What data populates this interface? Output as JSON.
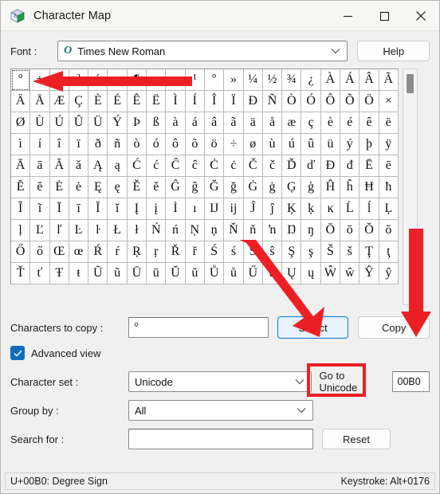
{
  "window": {
    "title": "Character Map",
    "icon": "character-map-icon",
    "minimize": "minimize-icon",
    "maximize": "maximize-icon",
    "close": "close-icon"
  },
  "font_row": {
    "label": "Font :",
    "value": "Times New Roman",
    "type_badge": "O",
    "help_label": "Help"
  },
  "grid": {
    "selected_index": 0,
    "rows": [
      [
        "°",
        "±",
        "²",
        "³",
        "´",
        "µ",
        "¶",
        "·",
        "¸",
        "¹",
        "º",
        "»",
        "¼",
        "½",
        "¾",
        "¿",
        "À",
        "Á",
        "Â",
        "Ã"
      ],
      [
        "Ä",
        "Å",
        "Æ",
        "Ç",
        "È",
        "É",
        "Ê",
        "Ë",
        "Ì",
        "Í",
        "Î",
        "Ï",
        "Ð",
        "Ñ",
        "Ò",
        "Ó",
        "Ô",
        "Õ",
        "Ö",
        "×"
      ],
      [
        "Ø",
        "Ù",
        "Ú",
        "Û",
        "Ü",
        "Ý",
        "Þ",
        "ß",
        "à",
        "á",
        "â",
        "ã",
        "ä",
        "å",
        "æ",
        "ç",
        "è",
        "é",
        "ê",
        "ë"
      ],
      [
        "ì",
        "í",
        "î",
        "ï",
        "ð",
        "ñ",
        "ò",
        "ó",
        "ô",
        "õ",
        "ö",
        "÷",
        "ø",
        "ù",
        "ú",
        "û",
        "ü",
        "ý",
        "þ",
        "ÿ"
      ],
      [
        "Ā",
        "ā",
        "Ă",
        "ă",
        "Ą",
        "ą",
        "Ć",
        "ć",
        "Ĉ",
        "ĉ",
        "Ċ",
        "ċ",
        "Č",
        "č",
        "Ď",
        "ď",
        "Đ",
        "đ",
        "Ē",
        "ē"
      ],
      [
        "Ĕ",
        "ĕ",
        "Ė",
        "ė",
        "Ę",
        "ę",
        "Ě",
        "ě",
        "Ĝ",
        "ĝ",
        "Ğ",
        "ğ",
        "Ġ",
        "ġ",
        "Ģ",
        "ģ",
        "Ĥ",
        "ĥ",
        "Ħ",
        "ħ"
      ],
      [
        "Ĩ",
        "ĩ",
        "Ī",
        "ī",
        "Ĭ",
        "ĭ",
        "Į",
        "į",
        "İ",
        "ı",
        "Ĳ",
        "ĳ",
        "Ĵ",
        "ĵ",
        "Ķ",
        "ķ",
        "ĸ",
        "Ĺ",
        "ĺ",
        "Ļ"
      ],
      [
        "ļ",
        "Ľ",
        "ľ",
        "Ŀ",
        "ŀ",
        "Ł",
        "ł",
        "Ń",
        "ń",
        "Ņ",
        "ņ",
        "Ň",
        "ň",
        "ŉ",
        "Ŋ",
        "ŋ",
        "Ō",
        "ō",
        "Ŏ",
        "ŏ"
      ],
      [
        "Ő",
        "ő",
        "Œ",
        "œ",
        "Ŕ",
        "ŕ",
        "Ŗ",
        "ŗ",
        "Ř",
        "ř",
        "Ś",
        "ś",
        "Ŝ",
        "ŝ",
        "Ş",
        "ş",
        "Š",
        "š",
        "Ţ",
        "ţ"
      ],
      [
        "Ť",
        "ť",
        "Ŧ",
        "ŧ",
        "Ũ",
        "ũ",
        "Ū",
        "ū",
        "Ŭ",
        "ŭ",
        "Ů",
        "ů",
        "Ű",
        "ű",
        "Ų",
        "ų",
        "Ŵ",
        "ŵ",
        "Ŷ",
        "ŷ"
      ]
    ]
  },
  "copy_row": {
    "label": "Characters to copy :",
    "value": "°",
    "select_label": "Select",
    "copy_label": "Copy"
  },
  "advanced": {
    "label": "Advanced view",
    "checked": true,
    "check_icon": "checkmark-icon"
  },
  "charset_row": {
    "label": "Character set :",
    "value": "Unicode",
    "goto_label": "Go to Unicode",
    "goto_value": "00B0"
  },
  "groupby_row": {
    "label": "Group by :",
    "value": "All"
  },
  "search_row": {
    "label": "Search for :",
    "value": "",
    "reset_label": "Reset"
  },
  "status": {
    "left": "U+00B0: Degree Sign",
    "right": "Keystroke: Alt+0176"
  },
  "annotations": {
    "color": "#ec2024",
    "arrow_to_first_cell": "red-arrow-left",
    "arrow_to_select": "red-arrow-select",
    "arrow_to_copy": "red-arrow-copy",
    "highlight_goto": "red-highlight-box"
  }
}
